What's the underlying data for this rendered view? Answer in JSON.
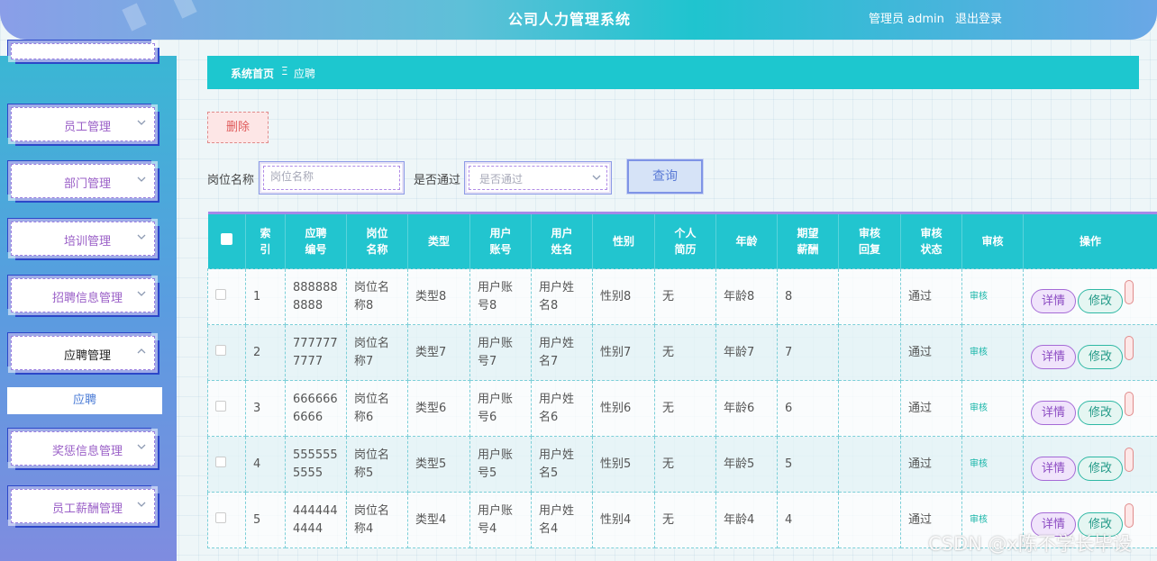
{
  "header": {
    "title": "公司人力管理系统",
    "user": "管理员 admin",
    "logout": "退出登录"
  },
  "sidebar": {
    "items": [
      {
        "label": "员工管理",
        "icon": "chevron-down-icon"
      },
      {
        "label": "部门管理",
        "icon": "chevron-down-icon"
      },
      {
        "label": "培训管理",
        "icon": "chevron-down-icon"
      },
      {
        "label": "招聘信息管理",
        "icon": "chevron-down-icon"
      },
      {
        "label": "应聘管理",
        "icon": "chevron-up-icon"
      },
      {
        "label": "奖惩信息管理",
        "icon": "chevron-down-icon"
      },
      {
        "label": "员工薪酬管理",
        "icon": "chevron-down-icon"
      }
    ],
    "submenu": {
      "label": "应聘"
    }
  },
  "breadcrumb": {
    "home": "系统首页",
    "sep": "Ξ",
    "current": "应聘"
  },
  "toolbar": {
    "delete_label": "删除",
    "search_label": "查询"
  },
  "search": {
    "position_label": "岗位名称",
    "position_placeholder": "岗位名称",
    "passed_label": "是否通过",
    "passed_placeholder": "是否通过"
  },
  "table": {
    "headers": [
      "",
      "索引",
      "应聘编号",
      "岗位名称",
      "类型",
      "用户账号",
      "用户姓名",
      "性别",
      "个人简历",
      "年龄",
      "期望薪酬",
      "审核回复",
      "审核状态",
      "审核",
      "操作"
    ],
    "header_lines": [
      [
        ""
      ],
      [
        "索",
        "引"
      ],
      [
        "应聘",
        "编号"
      ],
      [
        "岗位",
        "名称"
      ],
      [
        "类型"
      ],
      [
        "用户",
        "账号"
      ],
      [
        "用户",
        "姓名"
      ],
      [
        "性别"
      ],
      [
        "个人",
        "简历"
      ],
      [
        "年龄"
      ],
      [
        "期望",
        "薪酬"
      ],
      [
        "审核",
        "回复"
      ],
      [
        "审核",
        "状态"
      ],
      [
        "审核"
      ],
      [
        "操作"
      ]
    ],
    "rows": [
      {
        "index": "1",
        "code": "8888888888",
        "position": "岗位名称8",
        "type": "类型8",
        "account": "用户账号8",
        "name": "用户姓名8",
        "gender": "性别8",
        "resume": "无",
        "age": "年龄8",
        "salary": "8",
        "reply": "",
        "status": "通过",
        "audit": "审核",
        "detail": "详情",
        "edit": "修改"
      },
      {
        "index": "2",
        "code": "7777777777",
        "position": "岗位名称7",
        "type": "类型7",
        "account": "用户账号7",
        "name": "用户姓名7",
        "gender": "性别7",
        "resume": "无",
        "age": "年龄7",
        "salary": "7",
        "reply": "",
        "status": "通过",
        "audit": "审核",
        "detail": "详情",
        "edit": "修改"
      },
      {
        "index": "3",
        "code": "6666666666",
        "position": "岗位名称6",
        "type": "类型6",
        "account": "用户账号6",
        "name": "用户姓名6",
        "gender": "性别6",
        "resume": "无",
        "age": "年龄6",
        "salary": "6",
        "reply": "",
        "status": "通过",
        "audit": "审核",
        "detail": "详情",
        "edit": "修改"
      },
      {
        "index": "4",
        "code": "5555555555",
        "position": "岗位名称5",
        "type": "类型5",
        "account": "用户账号5",
        "name": "用户姓名5",
        "gender": "性别5",
        "resume": "无",
        "age": "年龄5",
        "salary": "5",
        "reply": "",
        "status": "通过",
        "audit": "审核",
        "detail": "详情",
        "edit": "修改"
      },
      {
        "index": "5",
        "code": "4444444444",
        "position": "岗位名称4",
        "type": "类型4",
        "account": "用户账号4",
        "name": "用户姓名4",
        "gender": "性别4",
        "resume": "无",
        "age": "年龄4",
        "salary": "4",
        "reply": "",
        "status": "通过",
        "audit": "审核",
        "detail": "详情",
        "edit": "修改"
      }
    ]
  },
  "watermark": "CSDN @x陈不学长毕设",
  "colors": {
    "accent": "#1dc7cf",
    "sidebar_top": "#3ab7d4",
    "sidebar_bottom": "#7f8ce0",
    "menu_text": "#9a5fc7",
    "delete": "#e05b5b"
  }
}
